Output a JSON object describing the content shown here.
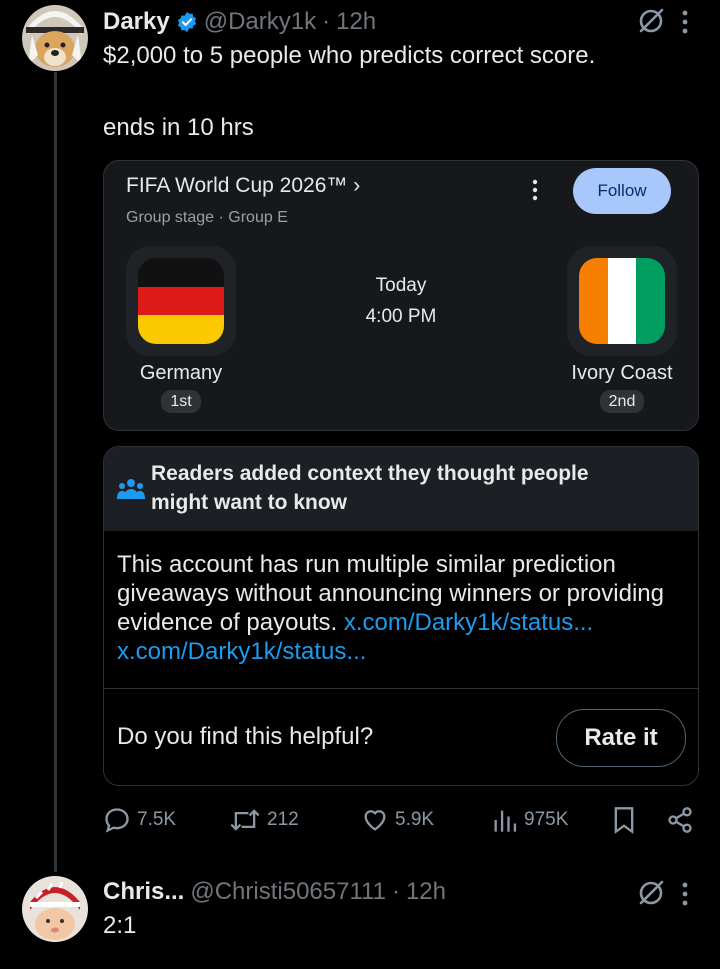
{
  "post": {
    "author_name": "Darky",
    "handle": "@Darky1k",
    "separator": "·",
    "time": "12h",
    "text": "$2,000 to 5 people who predicts correct score.",
    "poll_status": "ends in 10 hrs"
  },
  "match_card": {
    "title": "FIFA World Cup 2026™",
    "chevron": "›",
    "subtitle": "Group stage · Group E",
    "follow_label": "Follow",
    "day": "Today",
    "time": "4:00 PM",
    "home_team": "Germany",
    "home_rank": "1st",
    "away_team": "Ivory Coast",
    "away_rank": "2nd"
  },
  "community_note": {
    "header": "Readers added context they thought people might want to know",
    "body": "This account has run multiple similar prediction giveaways without announcing winners or providing evidence of payouts.",
    "link1": "x.com/Darky1k/status...",
    "link2": "x.com/Darky1k/status...",
    "question": "Do you find this helpful?",
    "rate_label": "Rate it"
  },
  "actions": {
    "replies": "7.5K",
    "reposts": "212",
    "likes": "5.9K",
    "views": "975K"
  },
  "reply": {
    "author_name": "Chris...",
    "handle": "@Christi50657111",
    "separator": "·",
    "time": "12h",
    "text": "2:1"
  },
  "colors": {
    "accent_blue": "#1d9bf0",
    "verified": "#1d9bf0",
    "follow_bg": "#a8c7fa",
    "note_icon": "#1d9bf0"
  }
}
